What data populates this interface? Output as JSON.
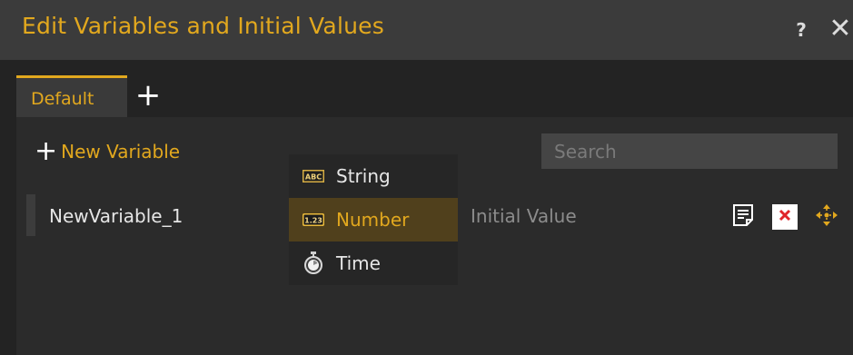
{
  "window": {
    "title": "Edit Variables and Initial Values",
    "help_label": "?",
    "close_label": "✕"
  },
  "tabs": [
    {
      "label": "Default",
      "active": true
    }
  ],
  "add_tab_label": "+",
  "toolbar": {
    "new_variable_plus": "+",
    "new_variable_label": "New Variable",
    "search_placeholder": "Search",
    "search_value": ""
  },
  "variables": [
    {
      "name": "NewVariable_1",
      "initial_value_placeholder": "Initial Value"
    }
  ],
  "type_dropdown": {
    "options": [
      {
        "label": "String",
        "icon": "abc-string-icon",
        "icon_text": "ABC",
        "selected": false
      },
      {
        "label": "Number",
        "icon": "number-123-icon",
        "icon_text": "1.23",
        "selected": true
      },
      {
        "label": "Time",
        "icon": "stopwatch-icon",
        "icon_text": "",
        "selected": false
      }
    ]
  },
  "row_actions": {
    "note_icon": "note-icon",
    "delete_icon": "delete-x-icon",
    "move_icon": "move-arrows-icon"
  },
  "colors": {
    "accent": "#e2a81e",
    "titlebar_bg": "#3b3b3b",
    "panel_bg": "#2b2b2b",
    "selected_bg": "#50401c",
    "delete_red": "#e0242a"
  }
}
